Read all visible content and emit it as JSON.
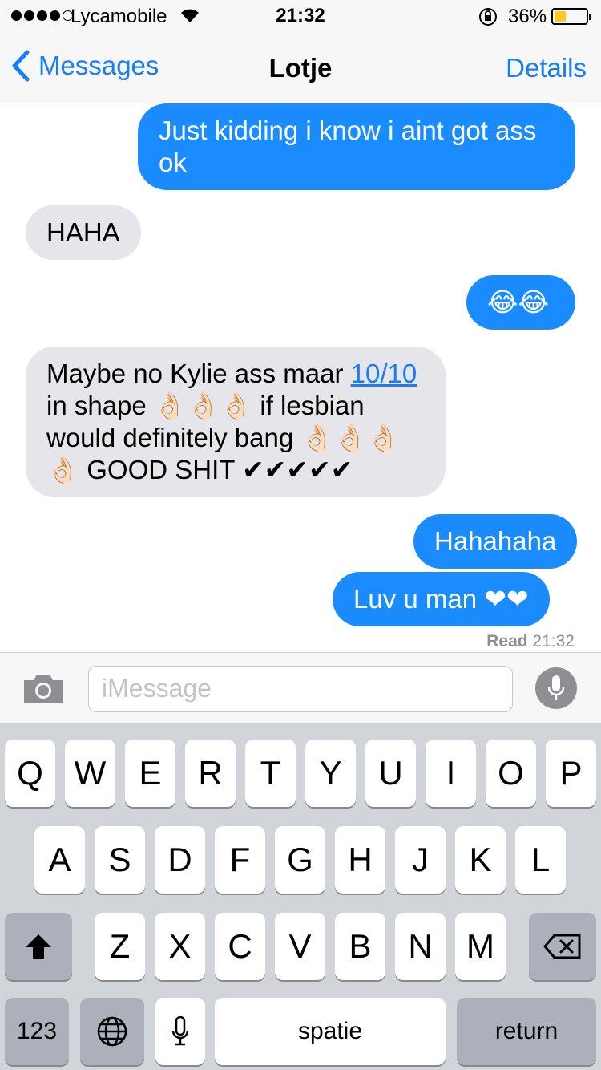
{
  "status": {
    "carrier": "Lycamobile",
    "time": "21:32",
    "battery_pct": "36%",
    "battery_level": 0.36,
    "signal_bars_filled": 4,
    "signal_bars_total": 5
  },
  "nav": {
    "back_label": "Messages",
    "title": "Lotje",
    "details_label": "Details"
  },
  "messages": [
    {
      "from": "me",
      "text": "Just kidding i know i aint got ass ok"
    },
    {
      "from": "them",
      "text": "HAHA"
    },
    {
      "from": "me",
      "text": "😂😂"
    },
    {
      "from": "them",
      "text_before": "Maybe no Kylie ass maar ",
      "link": "10/10",
      "text_after": " in shape 👌🏻👌🏻👌🏻 if lesbian would definitely bang 👌🏻👌🏻👌🏻👌🏻 GOOD SHIT ✔✔✔✔✔"
    },
    {
      "from": "me",
      "text": "Hahahaha"
    },
    {
      "from": "me",
      "text": "Luv u man ❤❤"
    }
  ],
  "receipt": {
    "label": "Read",
    "time": "21:32"
  },
  "input": {
    "placeholder": "iMessage"
  },
  "keyboard": {
    "row1": [
      "Q",
      "W",
      "E",
      "R",
      "T",
      "Y",
      "U",
      "I",
      "O",
      "P"
    ],
    "row2": [
      "A",
      "S",
      "D",
      "F",
      "G",
      "H",
      "J",
      "K",
      "L"
    ],
    "row3": [
      "Z",
      "X",
      "C",
      "V",
      "B",
      "N",
      "M"
    ],
    "numbers_label": "123",
    "space_label": "spatie",
    "return_label": "return"
  },
  "colors": {
    "accent": "#147efb",
    "outgoing": "#1a8cff",
    "incoming": "#e5e5ea",
    "keyboard_bg": "#d1d4d9"
  }
}
